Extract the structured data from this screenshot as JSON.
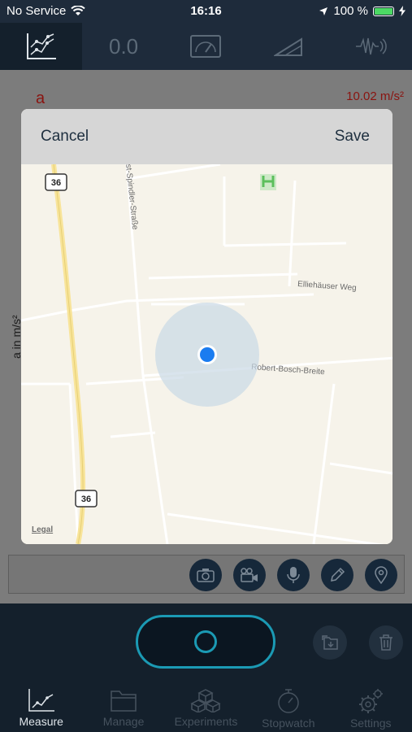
{
  "status_bar": {
    "carrier": "No Service",
    "time": "16:16",
    "battery_percent": "100 %",
    "battery_level": 1.0
  },
  "top_tabs": {
    "value_tab_text": "0.0"
  },
  "plot": {
    "label": "a",
    "value": "10.02 m/s²",
    "y_axis_label": "a in m/s²"
  },
  "modal": {
    "cancel_label": "Cancel",
    "save_label": "Save"
  },
  "map": {
    "road_shield_top": "36",
    "road_shield_bottom": "36",
    "street_1": "st-Spindler-Straße",
    "street_2": "Elliehäuser Weg",
    "street_3": "Robert-Bosch-Breite",
    "legal_label": "Legal"
  },
  "tab_bar": {
    "items": [
      {
        "label": "Measure"
      },
      {
        "label": "Manage"
      },
      {
        "label": "Experiments"
      },
      {
        "label": "Stopwatch"
      },
      {
        "label": "Settings"
      }
    ]
  },
  "colors": {
    "accent": "#1b9ab4",
    "location_dot": "#1a7cf0",
    "plot_text": "#8a1410"
  }
}
